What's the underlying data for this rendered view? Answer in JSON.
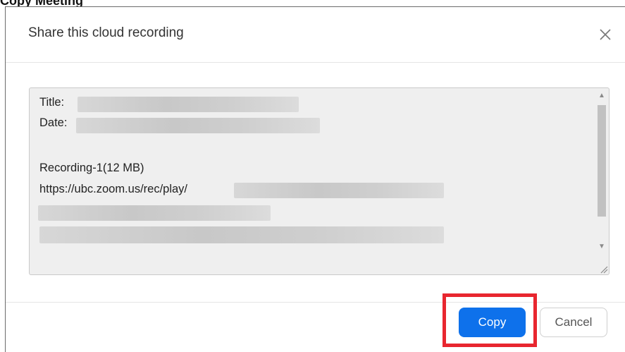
{
  "caption": "Copy Meeting",
  "dialog": {
    "title": "Share this cloud recording",
    "close_icon": "close-icon"
  },
  "share_text": {
    "title_label": "Title:",
    "date_label": "Date:",
    "recording_label": "Recording-1(12 MB)",
    "url_prefix": "https://ubc.zoom.us/rec/play/"
  },
  "buttons": {
    "copy_label": "Copy",
    "cancel_label": "Cancel"
  },
  "colors": {
    "primary": "#0e71eb",
    "highlight": "#e8262f"
  }
}
